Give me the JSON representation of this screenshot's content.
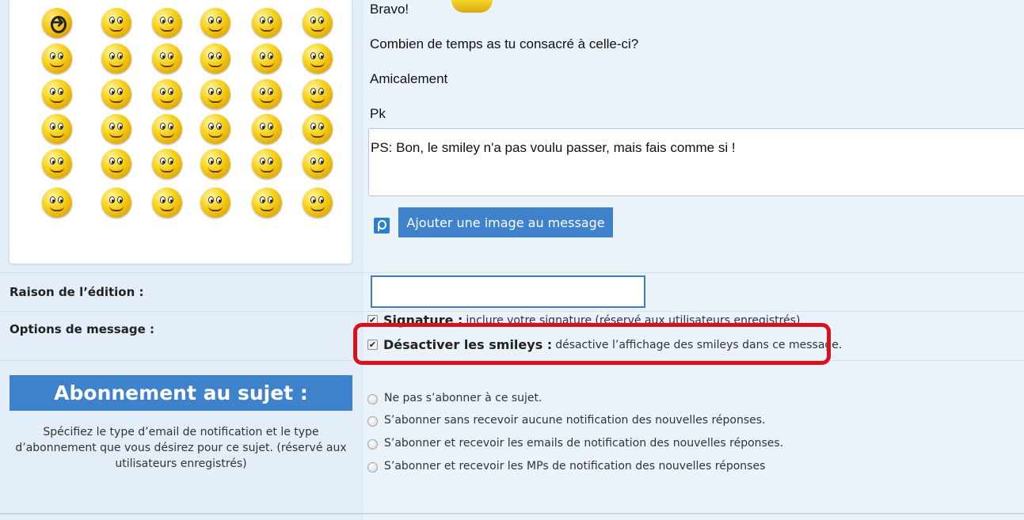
{
  "message": {
    "lines": [
      "Bravo!",
      "Combien de temps as tu consacré à celle-ci?",
      "Amicalement",
      "Pk"
    ],
    "ps": "PS: Bon, le smiley n'a pas voulu passer, mais fais comme si !"
  },
  "add_image_button": "Ajouter une image au message",
  "edit_reason": {
    "label": "Raison de l’édition :",
    "value": ""
  },
  "message_options": {
    "label": "Options de message :",
    "signature": {
      "title": "Signature :",
      "desc": "inclure votre signature (réservé aux utilisateurs enregistrés)",
      "checked": true
    },
    "disable_smileys": {
      "title": "Désactiver les smileys :",
      "desc": "désactive l’affichage des smileys dans ce message.",
      "checked": true
    },
    "highlight_color": "#d8121c"
  },
  "subscription": {
    "header": "Abonnement au sujet :",
    "description": "Spécifiez le type d’email de notification et le type d’abonnement que vous désirez pour ce sujet. (réservé aux utilisateurs enregistrés)",
    "options": [
      "Ne pas s’abonner à ce sujet.",
      "S’abonner sans recevoir aucune notification des nouvelles réponses.",
      "S’abonner et recevoir les emails de notification des nouvelles réponses.",
      "S’abonner et recevoir les MPs de notification des nouvelles réponses"
    ]
  },
  "colors": {
    "accent": "#3f82cc",
    "background": "#e3eef8"
  },
  "smileys": {
    "icon_names": [
      "arrow-smiley-icon",
      "thinking-smiley-icon",
      "surprised-smiley-icon",
      "wink-smiley-icon",
      "hiding-smiley-icon",
      "grin-smiley-icon",
      "cheer-smiley-icon",
      "graduate-smiley-icon",
      "sleep-smiley-icon",
      "crying-smiley-icon",
      "angry-smiley-icon",
      "glasses-smiley-icon",
      "frown-smiley-icon",
      "reading-smiley-icon",
      "worried-smiley-icon",
      "wave-smiley-icon",
      "thumbs-up-smiley-icon",
      "laugh-smiley-icon",
      "tongue-smiley-icon",
      "writing-smiley-icon",
      "flower-smiley-icon",
      "love-smiley-icon",
      "sign-smiley-icon",
      "cool-smiley-icon",
      "artist-smiley-icon",
      "weights-smiley-icon",
      "computer-smiley-icon",
      "hiding2-smiley-icon",
      "dance-smiley-icon",
      "smile-smiley-icon",
      "smirk-smiley-icon",
      "sneeze-smiley-icon",
      "yay-smiley-icon",
      "eyes-smiley-icon",
      "camera-smiley-icon",
      "pointing-smiley-icon"
    ]
  }
}
